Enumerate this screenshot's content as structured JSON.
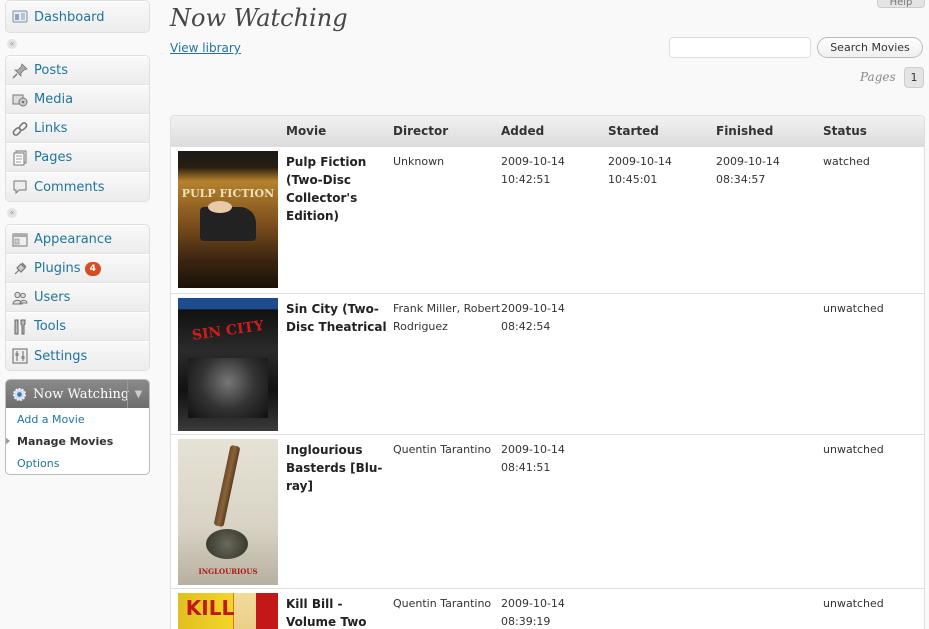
{
  "sidebar": {
    "group1": [
      {
        "label": "Dashboard",
        "icon": "dashboard-icon"
      }
    ],
    "group2": [
      {
        "label": "Posts",
        "icon": "pin-icon"
      },
      {
        "label": "Media",
        "icon": "media-icon"
      },
      {
        "label": "Links",
        "icon": "link-icon"
      },
      {
        "label": "Pages",
        "icon": "pages-icon"
      },
      {
        "label": "Comments",
        "icon": "comment-icon"
      }
    ],
    "group3": [
      {
        "label": "Appearance",
        "icon": "appearance-icon"
      },
      {
        "label": "Plugins",
        "icon": "plugin-icon",
        "badge": "4"
      },
      {
        "label": "Users",
        "icon": "users-icon"
      },
      {
        "label": "Tools",
        "icon": "tools-icon"
      },
      {
        "label": "Settings",
        "icon": "settings-icon"
      }
    ],
    "now_watching": {
      "label": "Now Watching",
      "items": [
        "Add a Movie",
        "Manage Movies",
        "Options"
      ],
      "current_index": 1
    }
  },
  "header": {
    "help": "Help",
    "title": "Now Watching",
    "view_library": "View library",
    "search_placeholder": "",
    "search_button": "Search Movies",
    "pages_label": "Pages",
    "page_number": "1"
  },
  "table": {
    "headers": {
      "movie": "Movie",
      "director": "Director",
      "added": "Added",
      "started": "Started",
      "finished": "Finished",
      "status": "Status"
    },
    "rows": [
      {
        "title": "Pulp Fiction (Two-Disc Collector's Edition)",
        "director": "Unknown",
        "added_date": "2009-10-14",
        "added_time": "10:42:51",
        "started_date": "2009-10-14",
        "started_time": "10:45:01",
        "finished_date": "2009-10-14",
        "finished_time": "08:34:57",
        "status": "watched",
        "poster_text": "PULP FICTION"
      },
      {
        "title": "Sin City (Two-Disc Theatrical",
        "director": "Frank Miller, Robert Rodriguez",
        "added_date": "2009-10-14",
        "added_time": "08:42:54",
        "started_date": "",
        "started_time": "",
        "finished_date": "",
        "finished_time": "",
        "status": "unwatched",
        "poster_text": "SIN CITY"
      },
      {
        "title": "Inglourious Basterds [Blu-ray]",
        "director": "Quentin Tarantino",
        "added_date": "2009-10-14",
        "added_time": "08:41:51",
        "started_date": "",
        "started_time": "",
        "finished_date": "",
        "finished_time": "",
        "status": "unwatched",
        "poster_text": "INGLOURIOUS BASTERDS"
      },
      {
        "title": "Kill Bill - Volume Two",
        "director": "Quentin Tarantino",
        "added_date": "2009-10-14",
        "added_time": "08:39:19",
        "started_date": "",
        "started_time": "",
        "finished_date": "",
        "finished_time": "",
        "status": "unwatched",
        "poster_text": "KILL"
      }
    ]
  },
  "colors": {
    "link": "#21759b",
    "badge": "#d54e21",
    "menu_active_header": "#7a7a7a"
  }
}
